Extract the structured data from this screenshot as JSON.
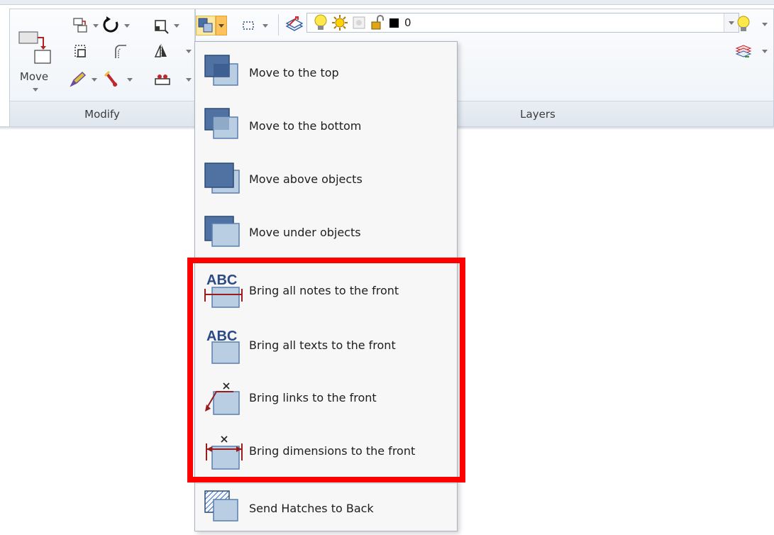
{
  "ribbon": {
    "panels": [
      {
        "name": "Modify"
      },
      {
        "name": "Layers"
      }
    ],
    "move_label": "Move",
    "layer_combo": {
      "value": "0"
    }
  },
  "menu": {
    "items": [
      {
        "label": "Move to the top",
        "icon": "move-to-top-icon"
      },
      {
        "label": "Move to the bottom",
        "icon": "move-to-bottom-icon"
      },
      {
        "label": "Move above objects",
        "icon": "move-above-icon"
      },
      {
        "label": "Move under objects",
        "icon": "move-under-icon"
      },
      {
        "label": "Bring all notes to the front",
        "icon": "notes-front-icon"
      },
      {
        "label": "Bring all texts to the front",
        "icon": "texts-front-icon"
      },
      {
        "label": "Bring links to the front",
        "icon": "links-front-icon"
      },
      {
        "label": "Bring dimensions to the front",
        "icon": "dimensions-front-icon"
      },
      {
        "label": "Send Hatches to Back",
        "icon": "hatches-back-icon"
      }
    ],
    "icon_text": "ABC"
  },
  "colors": {
    "highlight": "#ff0000",
    "icon_blue": "#5b7fae",
    "icon_light": "#b9cde3",
    "dark_red": "#9a1c1c"
  }
}
